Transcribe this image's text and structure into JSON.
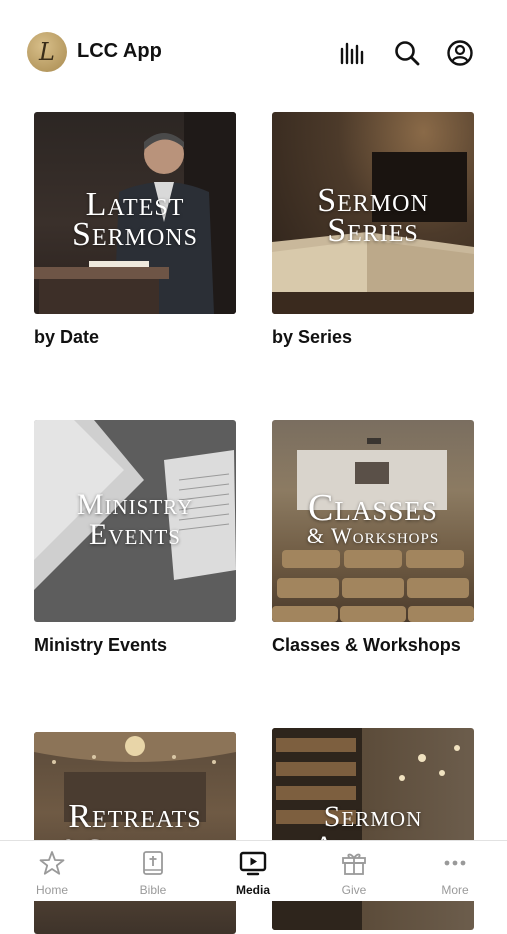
{
  "header": {
    "logo_letter": "L",
    "app_title": "LCC App",
    "icons": [
      "audio-bars-icon",
      "search-icon",
      "account-icon"
    ]
  },
  "tiles": [
    {
      "overlay_line1": "Latest",
      "overlay_line2": "Sermons",
      "caption": "by Date"
    },
    {
      "overlay_line1": "Sermon",
      "overlay_line2": "Series",
      "caption": "by Series"
    },
    {
      "overlay_line1": "Ministry",
      "overlay_line2": "Events",
      "caption": "Ministry Events"
    },
    {
      "overlay_line1": "Classes",
      "overlay_line2": "& Workshops",
      "caption": "Classes & Workshops"
    },
    {
      "overlay_line1": "Retreats",
      "overlay_line2": "& Conferences",
      "caption": ""
    },
    {
      "overlay_line1": "Sermon",
      "overlay_line2": "Archives",
      "caption": ""
    }
  ],
  "tabbar": {
    "items": [
      {
        "label": "Home",
        "icon": "star-icon",
        "active": false
      },
      {
        "label": "Bible",
        "icon": "bible-icon",
        "active": false
      },
      {
        "label": "Media",
        "icon": "tv-play-icon",
        "active": true
      },
      {
        "label": "Give",
        "icon": "gift-icon",
        "active": false
      },
      {
        "label": "More",
        "icon": "more-dots-icon",
        "active": false
      }
    ]
  },
  "colors": {
    "active": "#111111",
    "inactive": "#9a9a9a",
    "logo": "#c4a46a"
  }
}
